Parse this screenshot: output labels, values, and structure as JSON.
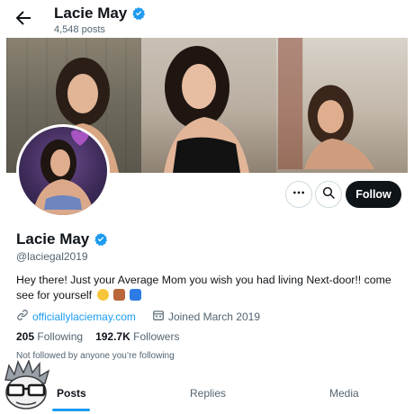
{
  "header": {
    "name": "Lacie May",
    "posts_count": "4,548 posts",
    "back_icon": "arrow-left-icon",
    "verified_icon": "verified-badge-icon"
  },
  "profile": {
    "name": "Lacie May",
    "handle": "@laciegal2019",
    "bio": "Hey there! Just your Average Mom you wish you had living Next-door!! come see for yourself",
    "bio_emojis": [
      "winking-face-emoji",
      "door-emoji",
      "down-arrow-emoji"
    ],
    "website": "officiallylaciemay.com",
    "joined": "Joined March 2019",
    "following_count": "205",
    "following_label": "Following",
    "followers_count": "192.7K",
    "followers_label": "Followers",
    "not_followed_note": "Not followed by anyone you’re following"
  },
  "actions": {
    "more_icon": "more-icon",
    "search_icon": "search-icon",
    "follow_label": "Follow"
  },
  "tabs": [
    {
      "label": "Posts",
      "active": true
    },
    {
      "label": "Replies",
      "active": false
    },
    {
      "label": "Media",
      "active": false
    }
  ],
  "colors": {
    "accent": "#1d9bf0",
    "text": "#0f1419",
    "muted": "#536471",
    "follow_button": "#0f1419"
  }
}
